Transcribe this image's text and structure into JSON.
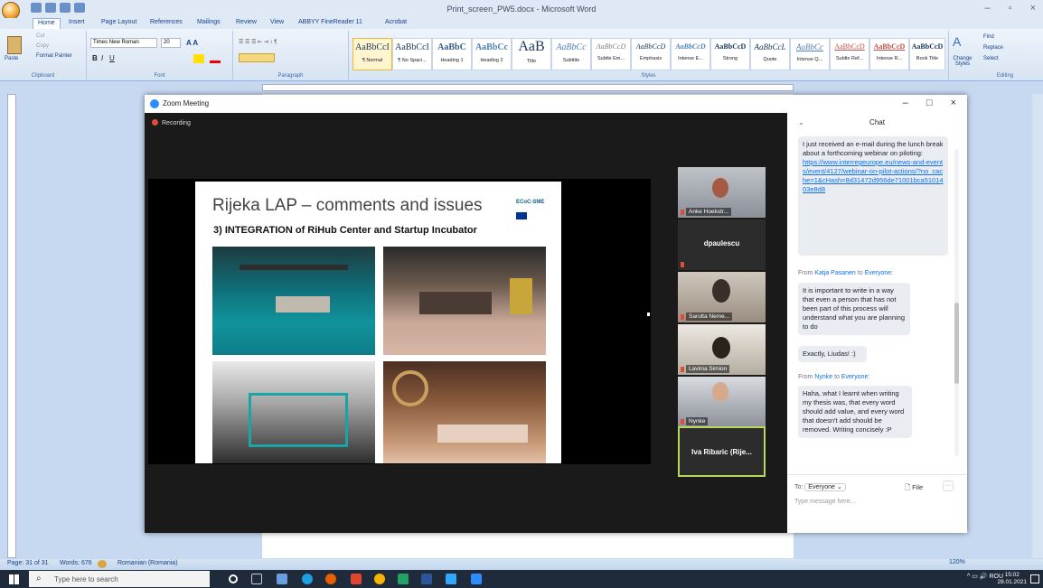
{
  "word": {
    "title": "Print_screen_PW5.docx - Microsoft Word",
    "tabs": [
      "Home",
      "Insert",
      "Page Layout",
      "References",
      "Mailings",
      "Review",
      "View",
      "ABBYY FineReader 11",
      "Acrobat"
    ],
    "clipboard": {
      "paste": "Paste",
      "cut": "Cut",
      "copy": "Copy",
      "format_painter": "Format Painter",
      "label": "Clipboard"
    },
    "font": {
      "name": "Times New Roman",
      "size": "20",
      "label": "Font"
    },
    "paragraph_label": "Paragraph",
    "styles": [
      {
        "sample": "AaBbCcI",
        "name": "¶ Normal"
      },
      {
        "sample": "AaBbCcI",
        "name": "¶ No Spaci..."
      },
      {
        "sample": "AaBbC",
        "name": "Heading 1"
      },
      {
        "sample": "AaBbCc",
        "name": "Heading 2"
      },
      {
        "sample": "AaB",
        "name": "Title"
      },
      {
        "sample": "AaBbCc",
        "name": "Subtitle"
      },
      {
        "sample": "AaBbCcD",
        "name": "Subtle Em..."
      },
      {
        "sample": "AaBbCcD",
        "name": "Emphasis"
      },
      {
        "sample": "AaBbCcD",
        "name": "Intense E..."
      },
      {
        "sample": "AaBbCcD",
        "name": "Strong"
      },
      {
        "sample": "AaBbCcL",
        "name": "Quote"
      },
      {
        "sample": "AaBbCc",
        "name": "Intense Q..."
      },
      {
        "sample": "AaBbCcD",
        "name": "Subtle Ref..."
      },
      {
        "sample": "AaBbCcD",
        "name": "Intense R..."
      },
      {
        "sample": "AaBbCcD",
        "name": "Book Title"
      }
    ],
    "styles_label": "Styles",
    "change_styles": "Change Styles",
    "editing": {
      "find": "Find",
      "replace": "Replace",
      "select": "Select",
      "label": "Editing"
    },
    "status": {
      "page": "Page: 31 of 31",
      "words": "Words: 676",
      "language": "Romanian (Romania)",
      "zoom": "120%"
    }
  },
  "zoom": {
    "title": "Zoom Meeting",
    "recording": "Recording",
    "slide": {
      "title": "Rijeka LAP – comments and issues",
      "subtitle": "3) INTEGRATION of RiHub Center and Startup Incubator",
      "logo": "ECoC-SME"
    },
    "participants": [
      {
        "name": "Anke Hoekstr...",
        "type": "video"
      },
      {
        "name": "dpaulescu",
        "type": "name"
      },
      {
        "name": "Sarolta Neme...",
        "type": "video"
      },
      {
        "name": "Lavinia Simion",
        "type": "video"
      },
      {
        "name": "Nynke",
        "type": "video"
      },
      {
        "name": "Iva Ribaric (Rije...",
        "type": "name",
        "active": true
      }
    ],
    "chat": {
      "header": "Chat",
      "msg1": "I just received an e-mail during the lunch break about a forthcoming webinar on piloting:",
      "msg1_link": "https://www.interregeurope.eu/news-and-events/event/4127/webinar-on-pilot-actions/?no_cache=1&cHash=8d31472d956de71001bca5101403e8d8",
      "from2_prefix": "From ",
      "from2_user": "Katja Pasanen",
      "from2_mid": " to ",
      "from2_to": "Everyone",
      "from2_suffix": ":",
      "msg2": "It is important to write in a way that even a person that has not been part of this process will understand what you are planning to do",
      "msg3": "Exactly, Liudas! :)",
      "from3_prefix": "From ",
      "from3_user": "Nynke",
      "from3_mid": " to ",
      "from3_to": "Everyone",
      "from3_suffix": ":",
      "msg4": "Haha, what I learnt when writing my thesis was, that every word should add value, and every word that doesn't add should be removed. Writing concisely :P",
      "to_label": "To:",
      "to_value": "Everyone ⌄",
      "file": "File",
      "placeholder": "Type message here..."
    }
  },
  "taskbar": {
    "search_placeholder": "Type here to search",
    "tray_lang": "ROU",
    "time": "15:02",
    "date": "28.01.2021"
  },
  "colors": {
    "word_accent": "#15428b",
    "zoom_blue": "#0e71eb",
    "active_border": "#b9d85b"
  }
}
